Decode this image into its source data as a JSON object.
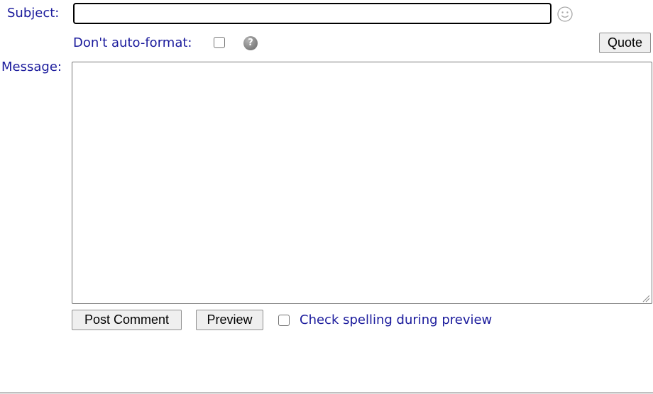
{
  "subject": {
    "label": "Subject:",
    "value": "",
    "smiley_icon": "smiley-icon"
  },
  "format": {
    "label": "Don't auto-format:",
    "checked": false,
    "help_icon": "help-icon",
    "help_glyph": "?"
  },
  "quote_button": "Quote",
  "message": {
    "label": "Message:",
    "value": ""
  },
  "actions": {
    "post_label": "Post Comment",
    "preview_label": "Preview",
    "spellcheck_label": "Check spelling during preview",
    "spellcheck_checked": false
  },
  "colors": {
    "label_text": "#1a1a9c",
    "button_bg": "#efefef",
    "border": "#767676"
  }
}
